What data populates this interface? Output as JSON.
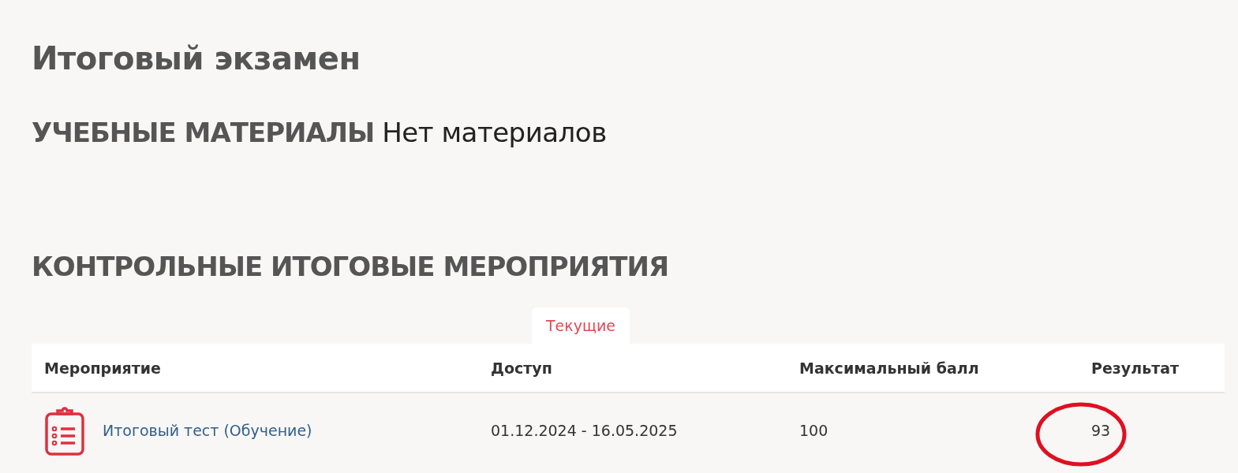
{
  "page_title": "Итоговый экзамен",
  "materials": {
    "heading": "УЧЕБНЫЕ МАТЕРИАЛЫ",
    "value": "Нет материалов"
  },
  "events": {
    "heading": "КОНТРОЛЬНЫЕ ИТОГОВЫЕ МЕРОПРИЯТИЯ",
    "tabs": [
      {
        "label": "Текущие",
        "selected": true
      }
    ],
    "columns": [
      "Мероприятие",
      "Доступ",
      "Максимальный балл",
      "Результат"
    ],
    "rows": [
      {
        "name": "Итоговый тест (Обучение)",
        "access": "01.12.2024 - 16.05.2025",
        "max_score": "100",
        "result": "93",
        "result_circled": true
      }
    ]
  }
}
